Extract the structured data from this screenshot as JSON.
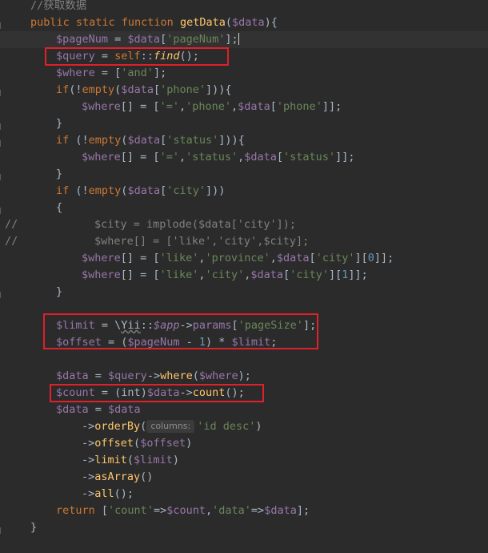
{
  "editor": {
    "comment_title": "//获取数据",
    "kw_public_static_function": "public static function ",
    "fn_getData": "getData",
    "param_data": "$data",
    "open_brace": "){",
    "l3_var": "$pageNum",
    "l3_eq": " = ",
    "l3_data": "$data",
    "l3_key": "'pageNum'",
    "l3_end": "];",
    "l4_var": "$query",
    "l4_self": "self",
    "l4_find": "find",
    "l4_end": "();",
    "l5_var": "$where",
    "l5_val": "'and'",
    "l6_if": "if",
    "l6_empty": "empty",
    "l6_data": "$data",
    "l6_key": "'phone'",
    "l7_where": "$where",
    "l7_eq": "'='",
    "l7_phone": "'phone'",
    "l7_data": "$data",
    "l7_key": "'phone'",
    "close_brace": "}",
    "l9_if": "if",
    "l9_empty": "empty",
    "l9_data": "$data",
    "l9_key": "'status'",
    "l10_where": "$where",
    "l10_eq": "'='",
    "l10_status": "'status'",
    "l10_data": "$data",
    "l10_key": "'status'",
    "l12_if": "if",
    "l12_empty": "empty",
    "l12_data": "$data",
    "l12_key": "'city'",
    "l13_brace": "{",
    "l14_slash": "//",
    "l14_text": "$city = implode($data['city']);",
    "l15_slash": "//",
    "l15_text": "$where[] = ['like','city',$city];",
    "l16_where": "$where",
    "l16_like": "'like'",
    "l16_prov": "'province'",
    "l16_data": "$data",
    "l16_key": "'city'",
    "l16_idx": "0",
    "l17_where": "$where",
    "l17_like": "'like'",
    "l17_city": "'city'",
    "l17_data": "$data",
    "l17_key": "'city'",
    "l17_idx": "1",
    "l20_limit": "$limit",
    "l20_yii": "Yii",
    "l20_app": "$app",
    "l20_params": "params",
    "l20_key": "'pageSize'",
    "l21_offset": "$offset",
    "l21_pagenum": "$pageNum",
    "l21_one": "1",
    "l21_limit": "$limit",
    "l23_data": "$data",
    "l23_query": "$query",
    "l23_where_fn": "where",
    "l23_where": "$where",
    "l24_count": "$count",
    "l24_int": "int",
    "l24_data": "$data",
    "l24_count_fn": "count",
    "l25_data": "$data",
    "l25_data2": "$data",
    "l26_orderby": "orderBy",
    "l26_hint": "columns:",
    "l26_val": "'id desc'",
    "l27_offset_fn": "offset",
    "l27_offset": "$offset",
    "l28_limit_fn": "limit",
    "l28_limit": "$limit",
    "l29_asarray": "asArray",
    "l30_all": "all",
    "l31_return": "return",
    "l31_count_key": "'count'",
    "l31_count": "$count",
    "l31_data_key": "'data'",
    "l31_data": "$data"
  },
  "colors": {
    "background": "#2b2b2b",
    "keyword": "#cc7832",
    "variable": "#9876aa",
    "string": "#6a8759",
    "number": "#6897bb",
    "function": "#ffc66d",
    "comment": "#808080",
    "highlight_box": "#e0202a"
  }
}
